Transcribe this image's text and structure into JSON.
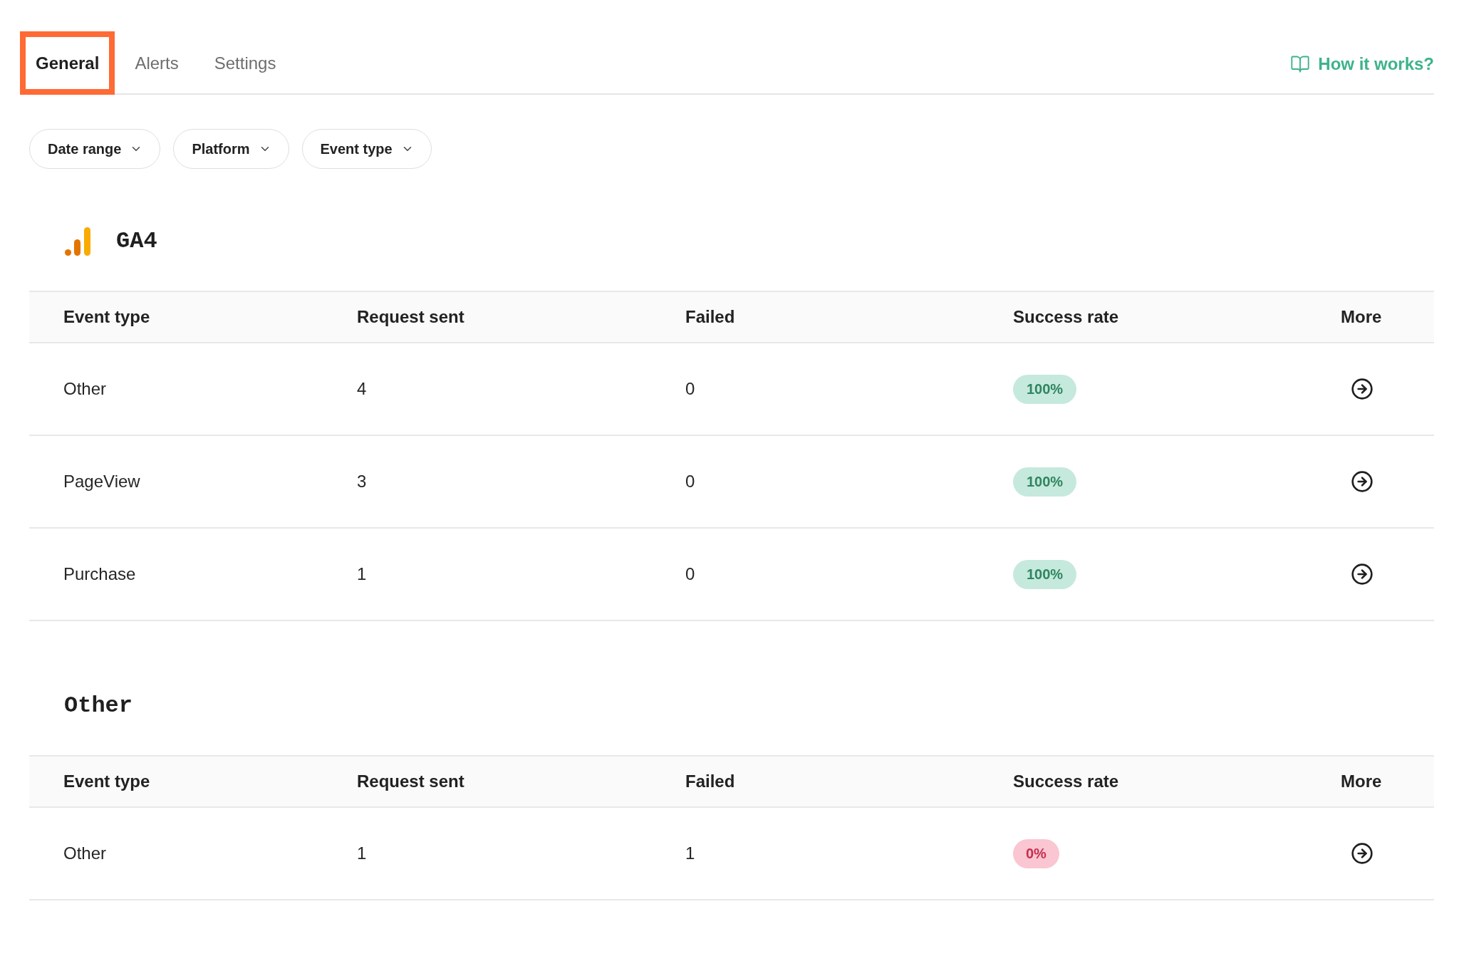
{
  "tabs": [
    {
      "label": "General",
      "selected": true,
      "highlighted": true
    },
    {
      "label": "Alerts",
      "selected": false,
      "highlighted": false
    },
    {
      "label": "Settings",
      "selected": false,
      "highlighted": false
    }
  ],
  "help_link": {
    "label": "How it works?"
  },
  "filters": [
    {
      "label": "Date range"
    },
    {
      "label": "Platform"
    },
    {
      "label": "Event type"
    }
  ],
  "sections": [
    {
      "title": "GA4",
      "kind": "analytics",
      "columns": [
        "Event type",
        "Request sent",
        "Failed",
        "Success rate",
        "More"
      ],
      "rows": [
        {
          "event_type": "Other",
          "requests_sent": "4",
          "failed": "0",
          "success_rate": "100%",
          "healthy": true
        },
        {
          "event_type": "PageView",
          "requests_sent": "3",
          "failed": "0",
          "success_rate": "100%",
          "healthy": true
        },
        {
          "event_type": "Purchase",
          "requests_sent": "1",
          "failed": "0",
          "success_rate": "100%",
          "healthy": true
        }
      ]
    },
    {
      "title": "Other",
      "kind": "plain",
      "columns": [
        "Event type",
        "Request sent",
        "Failed",
        "Success rate",
        "More"
      ],
      "rows": [
        {
          "event_type": "Other",
          "requests_sent": "1",
          "failed": "1",
          "success_rate": "0%",
          "healthy": false
        }
      ]
    }
  ]
}
